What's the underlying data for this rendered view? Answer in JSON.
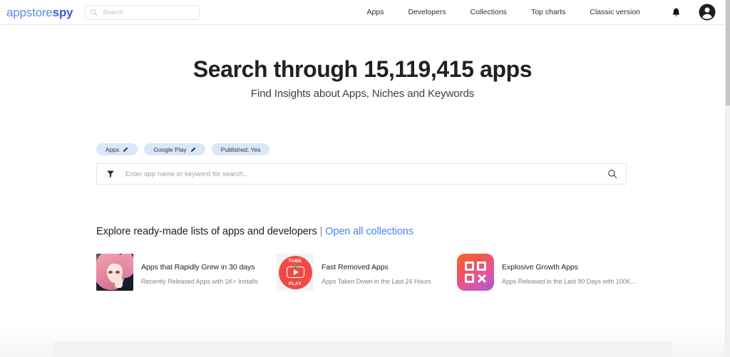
{
  "header": {
    "brand_light": "appstore",
    "brand_bold": "spy",
    "search": {
      "placeholder": "Search",
      "value": "",
      "icon": "search-icon"
    },
    "nav": [
      {
        "label": "Apps"
      },
      {
        "label": "Developers"
      },
      {
        "label": "Collections"
      },
      {
        "label": "Top charts"
      },
      {
        "label": "Classic version"
      }
    ],
    "notifications_icon": "bell-icon",
    "account_icon": "user-avatar-icon"
  },
  "hero": {
    "title": "Search through 15,119,415 apps",
    "subtitle": "Find Insights about Apps, Niches and Keywords",
    "app_count": "15,119,415"
  },
  "filters": {
    "chips": [
      {
        "label": "Apps",
        "icon": "pencil-icon",
        "editable": true
      },
      {
        "label": "Google Play",
        "icon": "pencil-icon",
        "editable": true
      },
      {
        "label": "Published: Yes",
        "icon": "",
        "editable": false
      }
    ],
    "chip_bg_color": "#dae7f8"
  },
  "search_panel": {
    "filter_icon": "funnel-icon",
    "placeholder": "Enter app name or keyword for search...",
    "value": "",
    "submit_icon": "search-icon"
  },
  "collections": {
    "heading_text": "Explore ready-made lists of apps and developers",
    "separator": "|",
    "link_text": "Open all collections",
    "link_color": "#4285f4",
    "items": [
      {
        "title": "Apps that Rapidly Grew in 30 days",
        "subtitle": "Recently Released Apps with 1K+ Installs",
        "icon": "anime-character-icon"
      },
      {
        "title": "Fast Removed Apps",
        "subtitle": "Apps Taken Down in the Last 24 Hours",
        "icon": "tube-play-icon",
        "icon_text_top": "TUBE",
        "icon_text_bottom": "PLAY"
      },
      {
        "title": "Explosive Growth Apps",
        "subtitle": "Apps Released in the Last 90 Days with 100K...",
        "icon": "qr-code-icon"
      }
    ]
  },
  "scrollbar": {
    "position": "top"
  }
}
